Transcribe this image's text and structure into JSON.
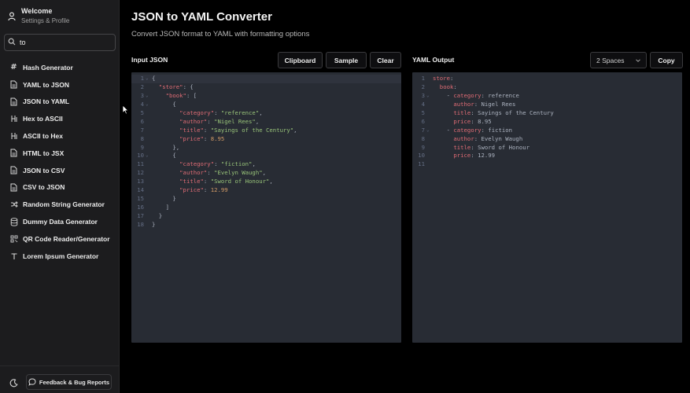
{
  "sidebar": {
    "profile": {
      "title": "Welcome",
      "subtitle": "Settings & Profile"
    },
    "search": {
      "value": "to",
      "placeholder": ""
    },
    "items": [
      {
        "label": "Hash Generator",
        "icon": "hash-icon"
      },
      {
        "label": "YAML to JSON",
        "icon": "file-icon"
      },
      {
        "label": "JSON to YAML",
        "icon": "file-icon"
      },
      {
        "label": "Hex to ASCII",
        "icon": "hex-icon"
      },
      {
        "label": "ASCII to Hex",
        "icon": "hex-icon"
      },
      {
        "label": "HTML to JSX",
        "icon": "file-icon"
      },
      {
        "label": "JSON to CSV",
        "icon": "file-icon"
      },
      {
        "label": "CSV to JSON",
        "icon": "file-icon"
      },
      {
        "label": "Random String Generator",
        "icon": "shuffle-icon"
      },
      {
        "label": "Dummy Data Generator",
        "icon": "database-icon"
      },
      {
        "label": "QR Code Reader/Generator",
        "icon": "qr-code-icon"
      },
      {
        "label": "Lorem Ipsum Generator",
        "icon": "text-icon"
      }
    ],
    "feedback_label": "Feedback & Bug Reports"
  },
  "main": {
    "title": "JSON to YAML Converter",
    "subtitle": "Convert JSON format to YAML with formatting options",
    "input": {
      "label": "Input JSON",
      "buttons": {
        "clipboard": "Clipboard",
        "sample": "Sample",
        "clear": "Clear"
      }
    },
    "output": {
      "label": "YAML Output",
      "indent_select": "2 Spaces",
      "copy": "Copy"
    }
  },
  "editor_json": [
    {
      "n": "1",
      "fold": true,
      "parts": [
        [
          "p",
          "{"
        ]
      ]
    },
    {
      "n": "2",
      "fold": false,
      "parts": [
        [
          "p",
          "  "
        ],
        [
          "k",
          "\"store\""
        ],
        [
          "p",
          ": {"
        ]
      ]
    },
    {
      "n": "3",
      "fold": true,
      "parts": [
        [
          "p",
          "    "
        ],
        [
          "k",
          "\"book\""
        ],
        [
          "p",
          ": ["
        ]
      ]
    },
    {
      "n": "4",
      "fold": true,
      "parts": [
        [
          "p",
          "      {"
        ]
      ]
    },
    {
      "n": "5",
      "fold": false,
      "parts": [
        [
          "p",
          "        "
        ],
        [
          "k",
          "\"category\""
        ],
        [
          "p",
          ": "
        ],
        [
          "s",
          "\"reference\""
        ],
        [
          "p",
          ","
        ]
      ]
    },
    {
      "n": "6",
      "fold": false,
      "parts": [
        [
          "p",
          "        "
        ],
        [
          "k",
          "\"author\""
        ],
        [
          "p",
          ": "
        ],
        [
          "s",
          "\"Nigel Rees\""
        ],
        [
          "p",
          ","
        ]
      ]
    },
    {
      "n": "7",
      "fold": false,
      "parts": [
        [
          "p",
          "        "
        ],
        [
          "k",
          "\"title\""
        ],
        [
          "p",
          ": "
        ],
        [
          "s",
          "\"Sayings of the Century\""
        ],
        [
          "p",
          ","
        ]
      ]
    },
    {
      "n": "8",
      "fold": false,
      "parts": [
        [
          "p",
          "        "
        ],
        [
          "k",
          "\"price\""
        ],
        [
          "p",
          ": "
        ],
        [
          "n",
          "8.95"
        ]
      ]
    },
    {
      "n": "9",
      "fold": false,
      "parts": [
        [
          "p",
          "      },"
        ]
      ]
    },
    {
      "n": "10",
      "fold": true,
      "parts": [
        [
          "p",
          "      {"
        ]
      ]
    },
    {
      "n": "11",
      "fold": false,
      "parts": [
        [
          "p",
          "        "
        ],
        [
          "k",
          "\"category\""
        ],
        [
          "p",
          ": "
        ],
        [
          "s",
          "\"fiction\""
        ],
        [
          "p",
          ","
        ]
      ]
    },
    {
      "n": "12",
      "fold": false,
      "parts": [
        [
          "p",
          "        "
        ],
        [
          "k",
          "\"author\""
        ],
        [
          "p",
          ": "
        ],
        [
          "s",
          "\"Evelyn Waugh\""
        ],
        [
          "p",
          ","
        ]
      ]
    },
    {
      "n": "13",
      "fold": false,
      "parts": [
        [
          "p",
          "        "
        ],
        [
          "k",
          "\"title\""
        ],
        [
          "p",
          ": "
        ],
        [
          "s",
          "\"Sword of Honour\""
        ],
        [
          "p",
          ","
        ]
      ]
    },
    {
      "n": "14",
      "fold": false,
      "parts": [
        [
          "p",
          "        "
        ],
        [
          "k",
          "\"price\""
        ],
        [
          "p",
          ": "
        ],
        [
          "n",
          "12.99"
        ]
      ]
    },
    {
      "n": "15",
      "fold": false,
      "parts": [
        [
          "p",
          "      }"
        ]
      ]
    },
    {
      "n": "16",
      "fold": false,
      "parts": [
        [
          "p",
          "    ]"
        ]
      ]
    },
    {
      "n": "17",
      "fold": false,
      "parts": [
        [
          "p",
          "  }"
        ]
      ]
    },
    {
      "n": "18",
      "fold": false,
      "parts": [
        [
          "p",
          "}"
        ]
      ]
    }
  ],
  "editor_yaml": [
    {
      "n": "1",
      "fold": false,
      "parts": [
        [
          "k",
          "store"
        ],
        [
          "p",
          ":"
        ]
      ]
    },
    {
      "n": "2",
      "fold": false,
      "parts": [
        [
          "p",
          "  "
        ],
        [
          "k",
          "book"
        ],
        [
          "p",
          ":"
        ]
      ]
    },
    {
      "n": "3",
      "fold": true,
      "parts": [
        [
          "p",
          "    - "
        ],
        [
          "k",
          "category"
        ],
        [
          "p",
          ": reference"
        ]
      ]
    },
    {
      "n": "4",
      "fold": false,
      "parts": [
        [
          "p",
          "      "
        ],
        [
          "k",
          "author"
        ],
        [
          "p",
          ": Nigel Rees"
        ]
      ]
    },
    {
      "n": "5",
      "fold": false,
      "parts": [
        [
          "p",
          "      "
        ],
        [
          "k",
          "title"
        ],
        [
          "p",
          ": Sayings of the Century"
        ]
      ]
    },
    {
      "n": "6",
      "fold": false,
      "parts": [
        [
          "p",
          "      "
        ],
        [
          "k",
          "price"
        ],
        [
          "p",
          ": 8.95"
        ]
      ]
    },
    {
      "n": "7",
      "fold": true,
      "parts": [
        [
          "p",
          "    - "
        ],
        [
          "k",
          "category"
        ],
        [
          "p",
          ": fiction"
        ]
      ]
    },
    {
      "n": "8",
      "fold": false,
      "parts": [
        [
          "p",
          "      "
        ],
        [
          "k",
          "author"
        ],
        [
          "p",
          ": Evelyn Waugh"
        ]
      ]
    },
    {
      "n": "9",
      "fold": false,
      "parts": [
        [
          "p",
          "      "
        ],
        [
          "k",
          "title"
        ],
        [
          "p",
          ": Sword of Honour"
        ]
      ]
    },
    {
      "n": "10",
      "fold": false,
      "parts": [
        [
          "p",
          "      "
        ],
        [
          "k",
          "price"
        ],
        [
          "p",
          ": 12.99"
        ]
      ]
    },
    {
      "n": "11",
      "fold": false,
      "parts": [
        [
          "p",
          ""
        ]
      ]
    }
  ],
  "colors": {
    "editor_bg": "#282c34",
    "key": "#e06c75",
    "string": "#98c379",
    "number": "#d19a66"
  }
}
